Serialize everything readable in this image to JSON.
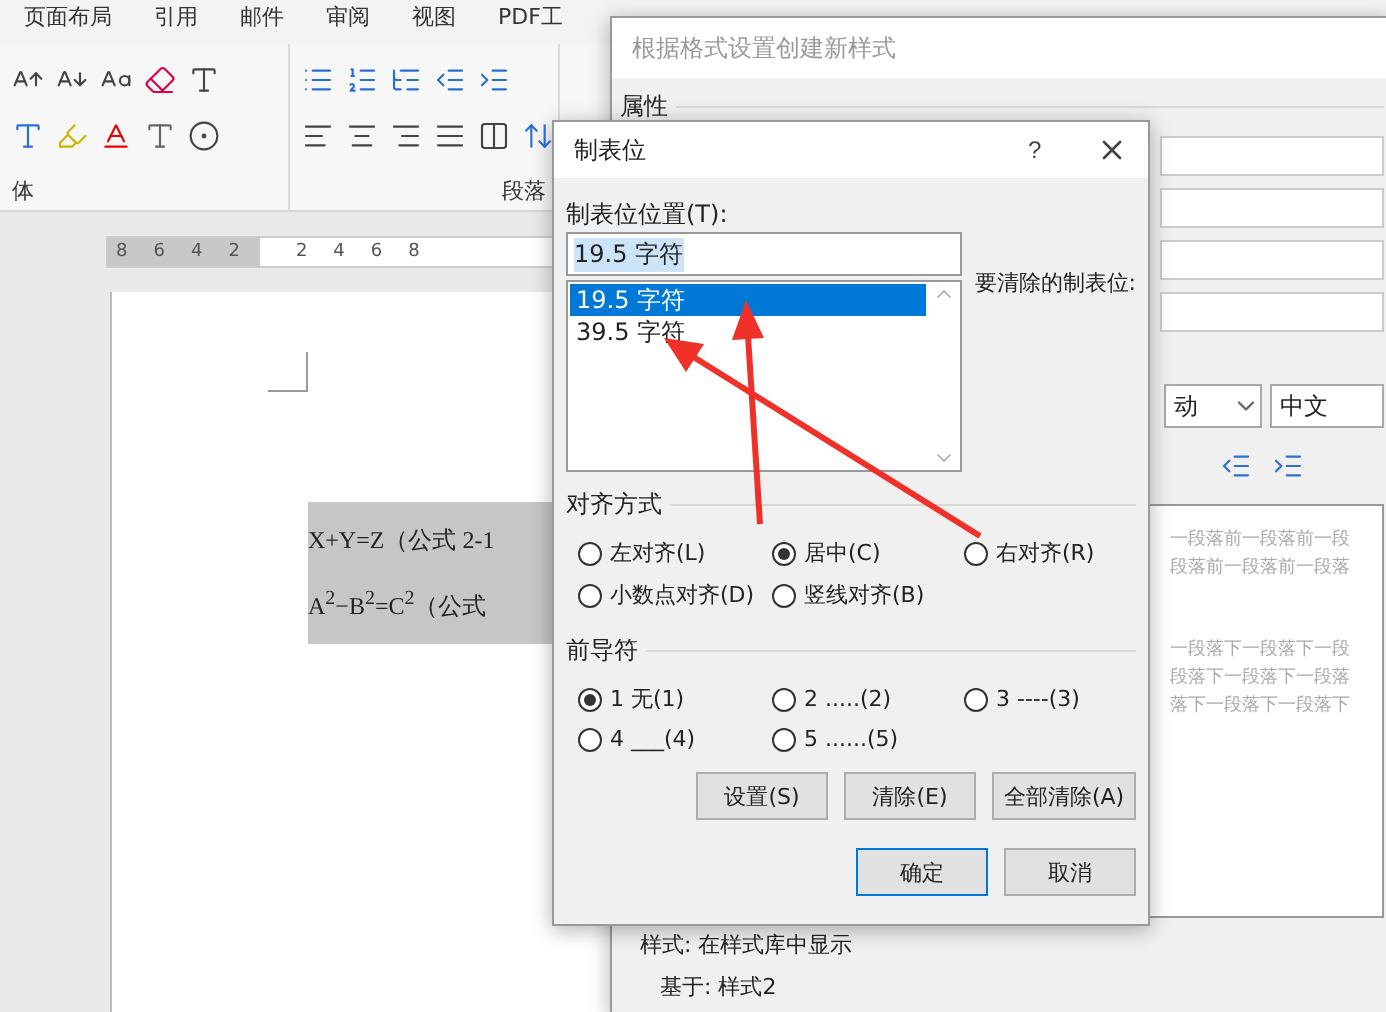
{
  "ribbon_tabs": [
    "页面布局",
    "引用",
    "邮件",
    "审阅",
    "视图",
    "PDF工"
  ],
  "ribbon_groups": [
    "体",
    "段落"
  ],
  "ruler": {
    "left_marks": [
      "8",
      "6",
      "4",
      "2"
    ],
    "right_marks": [
      "2",
      "4",
      "6",
      "8"
    ]
  },
  "document": {
    "lines": [
      "X+Y=Z（公式 2-1",
      "A$^{2}$−B$^{2}$=C$^{2}$（公式"
    ]
  },
  "style_dialog": {
    "title": "根据格式设置创建新样式",
    "section": "属性",
    "font_combo": "动",
    "language_combo": "中文",
    "preview_before": [
      "一段落前一段落前一段",
      "段落前一段落前一段落"
    ],
    "preview_after": [
      "一段落下一段落下一段",
      "段落下一段落下一段落",
      "落下一段落下一段落下"
    ],
    "info": [
      "样式: 在样式库中显示",
      "基于: 样式2"
    ]
  },
  "tabs_dialog": {
    "title": "制表位",
    "help": "?",
    "position_label": "制表位位置(T):",
    "position_value": "19.5 字符",
    "value_selected": true,
    "stops": [
      {
        "label": "19.5 字符",
        "selected": true
      },
      {
        "label": "39.5 字符",
        "selected": false
      }
    ],
    "clear_label": "要清除的制表位:",
    "alignment_title": "对齐方式",
    "alignment": [
      {
        "label": "左对齐(L)",
        "selected": false
      },
      {
        "label": "居中(C)",
        "selected": true
      },
      {
        "label": "右对齐(R)",
        "selected": false
      },
      {
        "label": "小数点对齐(D)",
        "selected": false
      },
      {
        "label": "竖线对齐(B)",
        "selected": false
      }
    ],
    "leader_title": "前导符",
    "leader": [
      {
        "label": "1 无(1)",
        "selected": true
      },
      {
        "label": "2 .....(2)",
        "selected": false
      },
      {
        "label": "3 ----(3)",
        "selected": false
      },
      {
        "label": "4 ___(4)",
        "selected": false
      },
      {
        "label": "5 ......(5)",
        "selected": false
      }
    ],
    "action_buttons": [
      "设置(S)",
      "清除(E)",
      "全部清除(A)"
    ],
    "ok": "确定",
    "cancel": "取消"
  }
}
